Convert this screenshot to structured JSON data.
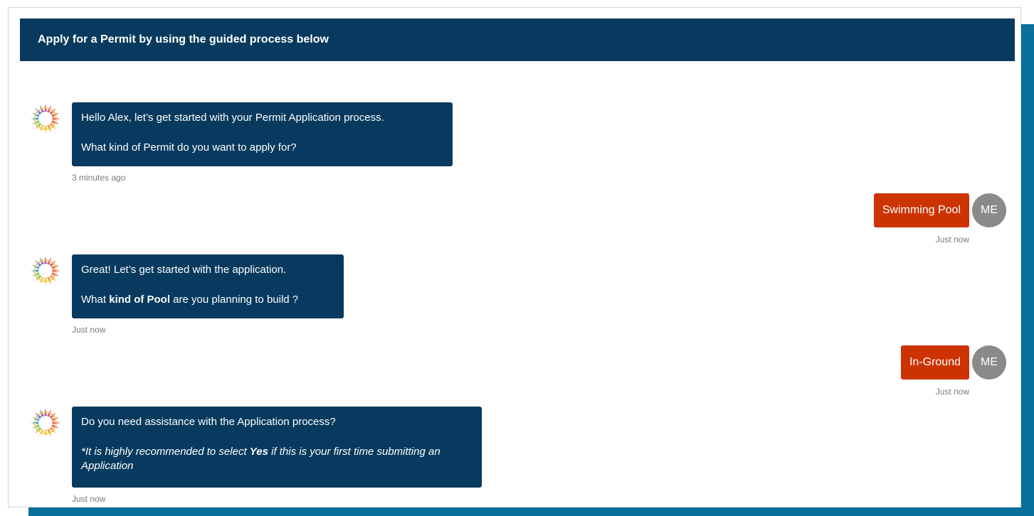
{
  "header": {
    "title": "Apply for a Permit by using the guided process below"
  },
  "messages": [
    {
      "sender": "bot",
      "lines": [
        "Hello Alex, let’s get started with your Permit Application process.",
        "What kind of Permit do you want to apply for?"
      ],
      "time": "3 minutes ago"
    },
    {
      "sender": "user",
      "avatar": "ME",
      "text": "Swimming Pool",
      "time": "Just now"
    },
    {
      "sender": "bot",
      "line1": "Great! Let’s get started with the application.",
      "line2": {
        "pre": "What ",
        "bold": "kind of Pool",
        "post": " are you planning to build ?"
      },
      "time": "Just now"
    },
    {
      "sender": "user",
      "avatar": "ME",
      "text": "In-Ground",
      "time": "Just now"
    },
    {
      "sender": "bot",
      "line1": "Do you need assistance with the Application process?",
      "note": {
        "pre": "*It is highly recommended to select ",
        "bold": "Yes",
        "post": " if this is your first time submitting an Application"
      },
      "time": "Just now"
    }
  ],
  "colors": {
    "header_bg": "#073a5e",
    "bot_bubble": "#073a5e",
    "user_bubble": "#cc3300",
    "me_avatar": "#8a8a8a",
    "accent_band": "#0a6f9a"
  },
  "icons": {
    "bot_avatar": "geometric-mandala-logo-icon"
  }
}
